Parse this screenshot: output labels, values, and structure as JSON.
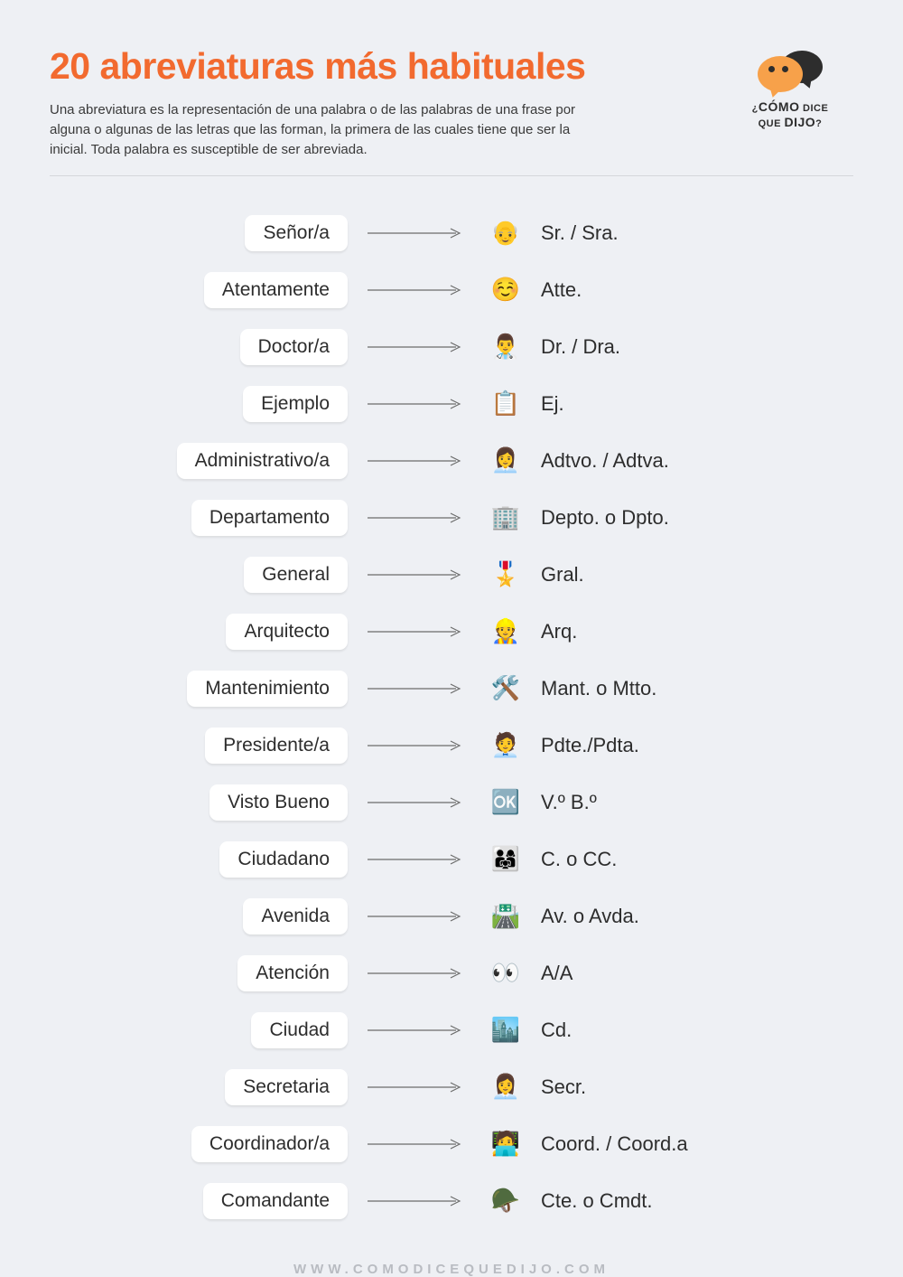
{
  "title": "20 abreviaturas más habituales",
  "subtitle": "Una abreviatura es la representación de una palabra o de las palabras de una frase por alguna o algunas de las letras que las forman, la primera de las cuales tiene que ser la inicial. Toda palabra es susceptible de ser abreviada.",
  "logo": {
    "line1_prefix": "¿",
    "line1_big": "CÓMO",
    "line1_suffix": " DICE",
    "line2_prefix": "QUE ",
    "line2_big": "DIJO",
    "line2_suffix": "?"
  },
  "rows": [
    {
      "word": "Señor/a",
      "emoji": "👴",
      "abbr": "Sr. / Sra."
    },
    {
      "word": "Atentamente",
      "emoji": "☺️",
      "abbr": "Atte."
    },
    {
      "word": "Doctor/a",
      "emoji": "👨‍⚕️",
      "abbr": "Dr. / Dra."
    },
    {
      "word": "Ejemplo",
      "emoji": "📋",
      "abbr": "Ej."
    },
    {
      "word": "Administrativo/a",
      "emoji": "👩‍💼",
      "abbr": "Adtvo. / Adtva."
    },
    {
      "word": "Departamento",
      "emoji": "🏢",
      "abbr": "Depto. o Dpto."
    },
    {
      "word": "General",
      "emoji": "🎖️",
      "abbr": "Gral."
    },
    {
      "word": "Arquitecto",
      "emoji": "👷",
      "abbr": "Arq."
    },
    {
      "word": "Mantenimiento",
      "emoji": "🛠️",
      "abbr": "Mant. o Mtto."
    },
    {
      "word": "Presidente/a",
      "emoji": "🧑‍💼",
      "abbr": "Pdte./Pdta."
    },
    {
      "word": "Visto Bueno",
      "emoji": "🆗",
      "abbr": "V.º B.º"
    },
    {
      "word": "Ciudadano",
      "emoji": "👨‍👩‍👧",
      "abbr": "C. o CC."
    },
    {
      "word": "Avenida",
      "emoji": "🛣️",
      "abbr": "Av. o Avda."
    },
    {
      "word": "Atención",
      "emoji": "👀",
      "abbr": "A/A"
    },
    {
      "word": "Ciudad",
      "emoji": "🏙️",
      "abbr": "Cd."
    },
    {
      "word": "Secretaria",
      "emoji": "👩‍💼",
      "abbr": "Secr."
    },
    {
      "word": "Coordinador/a",
      "emoji": "🧑‍💻",
      "abbr": "Coord. / Coord.a"
    },
    {
      "word": "Comandante",
      "emoji": "🪖",
      "abbr": "Cte. o Cmdt."
    }
  ],
  "footer": "WWW.COMODICEQUEDIJO.COM"
}
